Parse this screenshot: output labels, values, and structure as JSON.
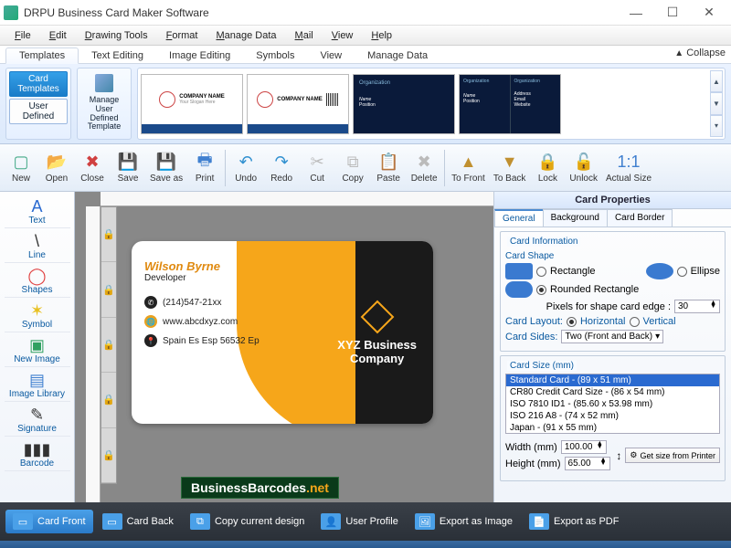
{
  "title": "DRPU Business Card Maker Software",
  "menubar": [
    "File",
    "Edit",
    "Drawing Tools",
    "Format",
    "Manage Data",
    "Mail",
    "View",
    "Help"
  ],
  "ribtabs": [
    "Templates",
    "Text Editing",
    "Image Editing",
    "Symbols",
    "View",
    "Manage Data"
  ],
  "collapse": "Collapse",
  "rib": {
    "card_templates": "Card Templates",
    "user_defined": "User Defined",
    "manage_udt": "Manage\nUser\nDefined\nTemplate"
  },
  "tpl": {
    "company": "COMPANY NAME",
    "slogan": "Your Slogan Here",
    "org": "Organization",
    "name": "Name",
    "pos": "Position",
    "addr": "Address",
    "email": "Email",
    "web": "Website"
  },
  "toolbar": [
    {
      "k": "new",
      "l": "New",
      "c": "#4a8"
    },
    {
      "k": "open",
      "l": "Open",
      "c": "#e8a030"
    },
    {
      "k": "close",
      "l": "Close",
      "c": "#d04040"
    },
    {
      "k": "save",
      "l": "Save",
      "c": "#4060c0"
    },
    {
      "k": "saveas",
      "l": "Save as",
      "c": "#4060c0"
    },
    {
      "k": "print",
      "l": "Print",
      "c": "#4080d0"
    },
    {
      "k": "sep"
    },
    {
      "k": "undo",
      "l": "Undo",
      "c": "#3090d0"
    },
    {
      "k": "redo",
      "l": "Redo",
      "c": "#3090d0"
    },
    {
      "k": "cut",
      "l": "Cut",
      "c": "#bbb"
    },
    {
      "k": "copy",
      "l": "Copy",
      "c": "#bbb"
    },
    {
      "k": "paste",
      "l": "Paste",
      "c": "#bbb"
    },
    {
      "k": "delete",
      "l": "Delete",
      "c": "#bbb"
    },
    {
      "k": "sep"
    },
    {
      "k": "tofront",
      "l": "To Front",
      "c": "#c09030"
    },
    {
      "k": "toback",
      "l": "To Back",
      "c": "#c09030"
    },
    {
      "k": "lock",
      "l": "Lock",
      "c": "#bbb"
    },
    {
      "k": "unlock",
      "l": "Unlock",
      "c": "#bbb"
    },
    {
      "k": "actual",
      "l": "Actual Size",
      "c": "#4080d0"
    }
  ],
  "left": [
    {
      "k": "text",
      "l": "Text",
      "i": "A",
      "c": "#2a6ad0"
    },
    {
      "k": "line",
      "l": "Line",
      "i": "\\",
      "c": "#333"
    },
    {
      "k": "shapes",
      "l": "Shapes",
      "i": "◯",
      "c": "#e04040"
    },
    {
      "k": "symbol",
      "l": "Symbol",
      "i": "✶",
      "c": "#e8c020"
    },
    {
      "k": "newimage",
      "l": "New Image",
      "i": "▣",
      "c": "#30a060"
    },
    {
      "k": "imagelib",
      "l": "Image Library",
      "i": "▤",
      "c": "#4080d0"
    },
    {
      "k": "signature",
      "l": "Signature",
      "i": "✎",
      "c": "#333"
    },
    {
      "k": "barcode",
      "l": "Barcode",
      "i": "▮▮▮",
      "c": "#333"
    }
  ],
  "card": {
    "name": "Wilson Byrne",
    "role": "Developer",
    "phone": "(214)547-21xx",
    "web": "www.abcdxyz.com",
    "addr": "Spain Es Esp 56532 Ep",
    "company1": "XYZ Business",
    "company2": "Company"
  },
  "watermark1": "BusinessBarcodes",
  "watermark2": ".net",
  "props": {
    "title": "Card Properties",
    "tabs": [
      "General",
      "Background",
      "Card Border"
    ],
    "card_info": "Card Information",
    "card_shape": "Card Shape",
    "rect": "Rectangle",
    "ellipse": "Ellipse",
    "rrect": "Rounded Rectangle",
    "px_edge_lbl": "Pixels for shape card edge :",
    "px_edge_val": "30",
    "layout_lbl": "Card Layout:",
    "horiz": "Horizontal",
    "vert": "Vertical",
    "sides_lbl": "Card Sides:",
    "sides_val": "Two (Front and Back)",
    "size_lbl": "Card Size (mm)",
    "sizes": [
      "Standard Card  -   (89 x 51 mm)",
      "CR80 Credit Card Size  -   (86 x 54 mm)",
      "ISO 7810 ID1  -   (85.60 x 53.98 mm)",
      "ISO 216  A8  -   (74 x 52 mm)",
      "Japan  -   (91 x 55 mm)"
    ],
    "width_lbl": "Width  (mm)",
    "width_val": "100.00",
    "height_lbl": "Height (mm)",
    "height_val": "65.00",
    "getsize": "Get size from Printer"
  },
  "bottom": [
    {
      "k": "front",
      "l": "Card Front",
      "active": true
    },
    {
      "k": "back",
      "l": "Card Back"
    },
    {
      "k": "copy",
      "l": "Copy current design"
    },
    {
      "k": "profile",
      "l": "User Profile"
    },
    {
      "k": "expimg",
      "l": "Export as Image"
    },
    {
      "k": "exppdf",
      "l": "Export as PDF"
    }
  ]
}
